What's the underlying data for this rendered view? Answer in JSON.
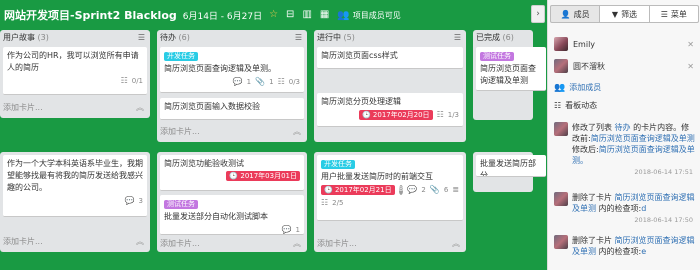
{
  "header": {
    "title": "网站开发项目-Sprint2 Blacklog",
    "dates": "6月14日 - 6月27日",
    "visibility": "项目成员可见"
  },
  "lists": [
    {
      "name": "用户故事",
      "count": "(3)",
      "add_label": "添加卡片...",
      "cards": [
        {
          "title": "作为公司的HR，我可以浏览所有申请人的简历",
          "badge": "0/1"
        },
        {
          "title": "作为一个大学本科英语系毕业生，我期望能够找最有将我的简历发送给我感兴趣的公司。",
          "comments": "3"
        }
      ]
    },
    {
      "name": "待办",
      "count": "(6)",
      "add_label": "添加卡片...",
      "cards": [
        {
          "label": "开发任务",
          "title": "简历浏览页面查询逻辑及单测。",
          "comments": "1",
          "attachments": "1",
          "check": "0/3"
        },
        {
          "title": "简历浏览页面输入数据校验"
        },
        {
          "title": "简历浏览功能验收测试",
          "due": "2017年03月01日"
        },
        {
          "label": "测试任务",
          "title": "批量发送部分自动化测试脚本",
          "comments": "1"
        }
      ]
    },
    {
      "name": "进行中",
      "count": "(5)",
      "add_label": "添加卡片...",
      "cards": [
        {
          "title": "简历浏览页面css样式"
        },
        {
          "title": "简历浏览分页处理逻辑",
          "due": "2017年02月20日",
          "check": "1/3"
        },
        {
          "label": "开发任务",
          "title": "用户批量发送简历时的前端交互",
          "due": "2017年02月21日",
          "circle": "B",
          "comments": "2",
          "attachments": "6",
          "check": "2/5"
        }
      ]
    },
    {
      "name": "已完成",
      "count": "(6)",
      "cards": [
        {
          "label": "测试任务",
          "title": "简历浏览页面查询逻辑及单测"
        },
        {
          "title": "批量发送简历部分"
        }
      ]
    }
  ],
  "panel": {
    "tabs": [
      {
        "icon": "person-icon",
        "label": "成员"
      },
      {
        "icon": "filter-icon",
        "label": "筛选"
      },
      {
        "icon": "menu-icon",
        "label": "菜单"
      }
    ],
    "members": [
      {
        "name": "Emily"
      },
      {
        "name": "圆不溜秋"
      }
    ],
    "add_member": "添加成员",
    "activity_title": "看板动态",
    "activities": [
      {
        "pre": "修改了列表 ",
        "list": "待办",
        "mid": " 的卡片内容。修改前:",
        "old": "简历浏览页面查询逻辑及单测",
        "mid2": "修改后:",
        "new": "简历浏览页面查询逻辑及单测。",
        "time": "2018-06-14 17:51"
      },
      {
        "pre": "删除了卡片 ",
        "card": "简历浏览页面查询逻辑及单测",
        "post": " 内的检查项:",
        "item": "d",
        "time": "2018-06-14 17:50"
      },
      {
        "pre": "删除了卡片 ",
        "card": "简历浏览页面查询逻辑及单测",
        "post": " 内的检查项:",
        "item": "e",
        "time": ""
      }
    ]
  }
}
